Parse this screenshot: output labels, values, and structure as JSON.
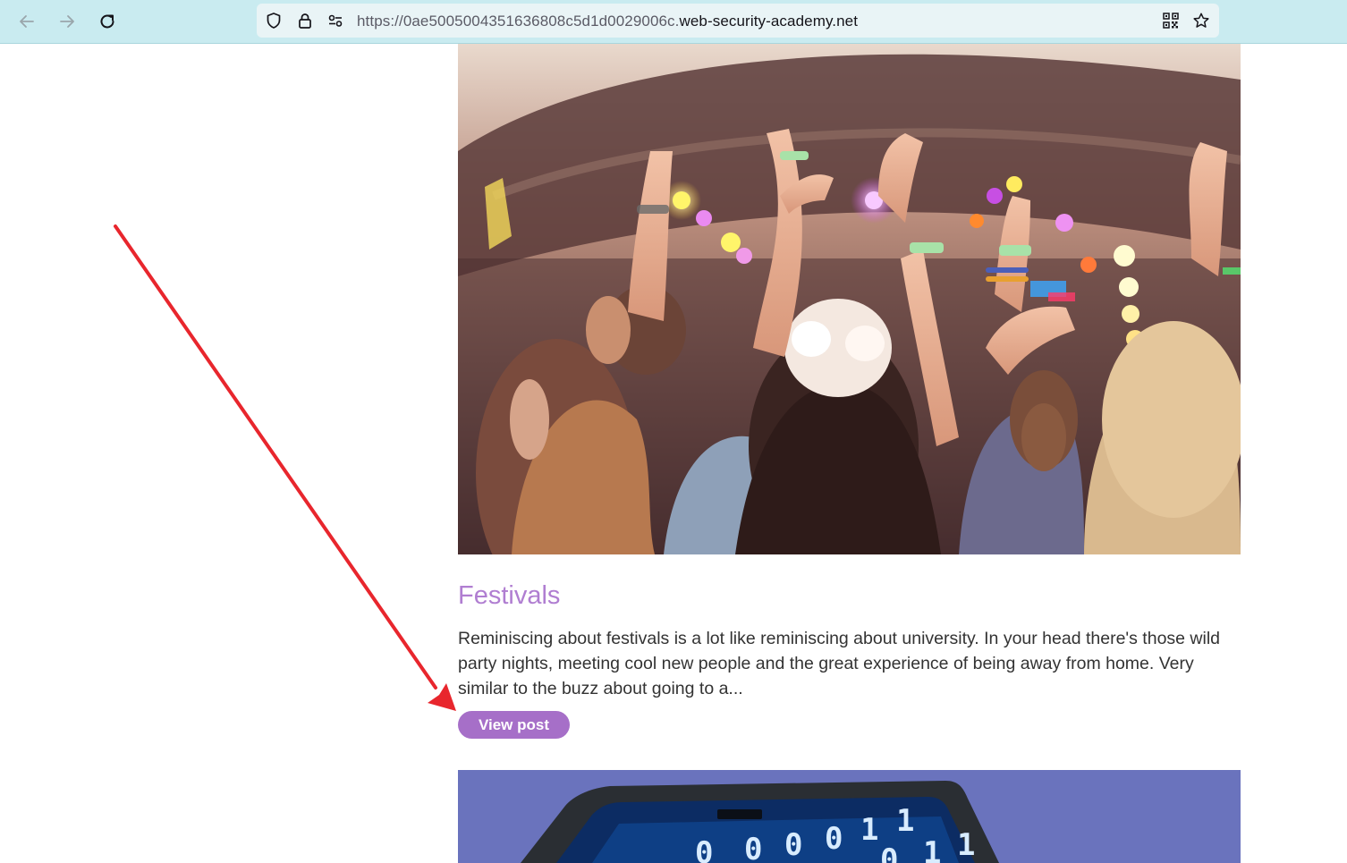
{
  "browser": {
    "url_prefix": "https://0ae5005004351636808c5d1d0029006c.",
    "url_domain": "web-security-academy.net",
    "icons": [
      "back-arrow-icon",
      "forward-arrow-icon",
      "reload-icon",
      "shield-icon",
      "lock-icon",
      "permissions-icon",
      "qr-code-icon",
      "star-icon"
    ]
  },
  "post": {
    "image_alt": "festival crowd photo",
    "title": "Festivals",
    "summary": "Reminiscing about festivals is a lot like reminiscing about university. In your head there's those wild party nights, meeting cool new people and the great experience of being away from home. Very similar to the buzz about going to a...",
    "button_label": "View post"
  },
  "next_post": {
    "image_alt": "laptop binary code photo",
    "binary_glyphs": [
      "0",
      "0",
      "0",
      "0",
      "1",
      "1",
      "0",
      "1",
      "1"
    ]
  },
  "colors": {
    "accent": "#a66fc8",
    "title": "#b07ed1",
    "annotation_arrow": "#e8262d",
    "toolbar": "#c9ebf0"
  }
}
